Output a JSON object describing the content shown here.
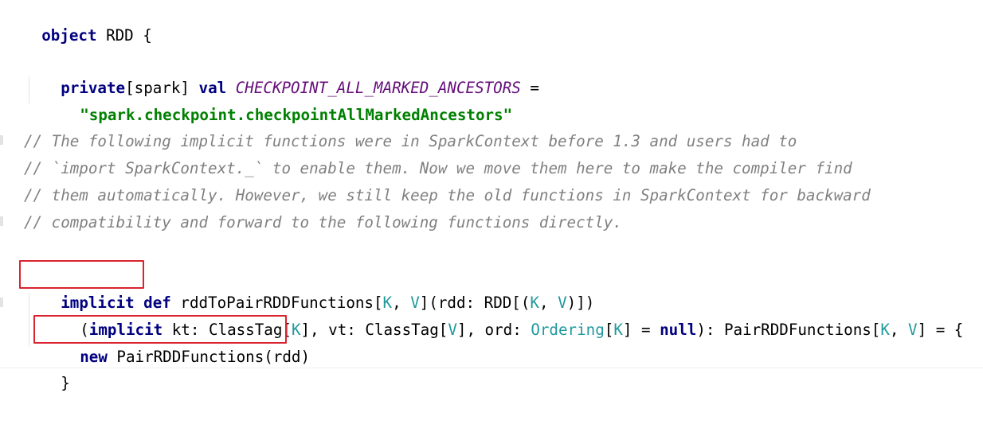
{
  "code": {
    "line1": {
      "kw": "object",
      "rest": " RDD {"
    },
    "line2": {
      "kw1": "private",
      "a": "[spark] ",
      "kw2": "val",
      "b": " ",
      "const": "CHECKPOINT_ALL_MARKED_ANCESTORS",
      "c": " ="
    },
    "line3": {
      "str": "\"spark.checkpoint.checkpointAllMarkedAncestors\""
    },
    "comments": [
      "// The following implicit functions were in SparkContext before 1.3 and users had to",
      "// `import SparkContext._` to enable them. Now we move them here to make the compiler find",
      "// them automatically. However, we still keep the old functions in SparkContext for backward",
      "// compatibility and forward to the following functions directly."
    ],
    "line8": {
      "kw": "implicit def",
      "a": " rddToPairRDDFunctions[",
      "t1": "K",
      "b": ", ",
      "t2": "V",
      "c": "](rdd: RDD[(",
      "t3": "K",
      "d": ", ",
      "t4": "V",
      "e": ")])"
    },
    "line9": {
      "p0": "(",
      "kw1": "implicit",
      "a": " kt: ClassTag[",
      "t1": "K",
      "b": "], vt: ClassTag[",
      "t2": "V",
      "c": "], ord: ",
      "ord": "Ordering",
      "d": "[",
      "t3": "K",
      "e": "] = ",
      "kw2": "null",
      "f": "): PairRDDFunctions[",
      "t4": "K",
      "g": ", ",
      "t5": "V",
      "h": "] = {"
    },
    "line10": {
      "kw": "new",
      "rest": " PairRDDFunctions(rdd)"
    },
    "line11": {
      "brace": "}"
    }
  }
}
